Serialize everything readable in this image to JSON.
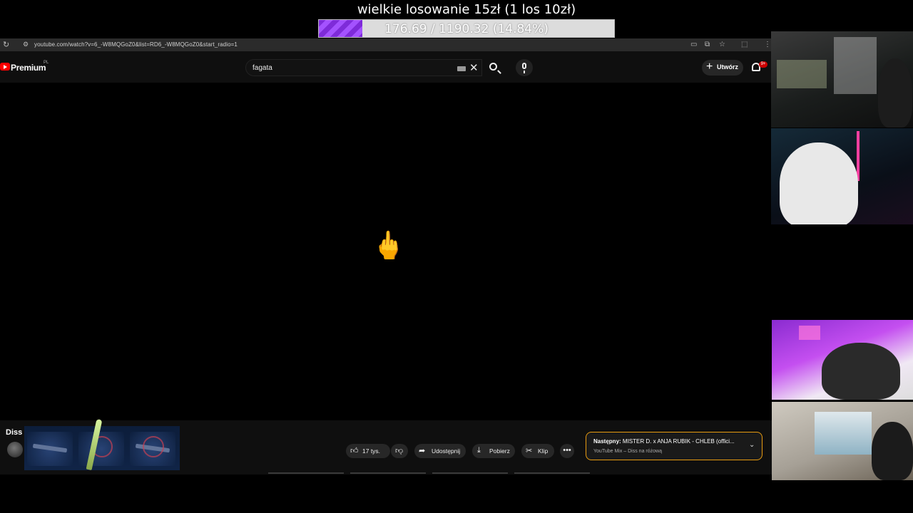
{
  "stream_goal": {
    "title": "wielkie losowanie 15zł (1 los 10zł)",
    "progress_text": "176.69 / 1190.32 (14.84%)",
    "progress_fraction": 0.1484,
    "fill_color": "#8a35e6"
  },
  "browser": {
    "reload_icon": "reload-icon",
    "url": "youtube.com/watch?v=6_-W8MQGoZ0&list=RD6_-W8MQGoZ0&start_radio=1"
  },
  "youtube": {
    "brand": "Premium",
    "region": "PL",
    "search_value": "fagata",
    "create_label": "Utwórz",
    "notification_count": "9+"
  },
  "video": {
    "overlay_emoji": "🖕",
    "title": "Diss",
    "actions": {
      "likes": "17 tys.",
      "share": "Udostępnij",
      "download": "Pobierz",
      "clip": "Klip",
      "more": "•••"
    },
    "next": {
      "prefix": "Następny:",
      "title": "MISTER D. x ANJA RUBIK - CHLEB (offici...",
      "subtitle": "YouTube Mix – Diss na różową"
    }
  },
  "colors": {
    "youtube_red": "#ff0000",
    "next_card_border": "#e79b10",
    "page_bg": "#0f0f0f"
  }
}
